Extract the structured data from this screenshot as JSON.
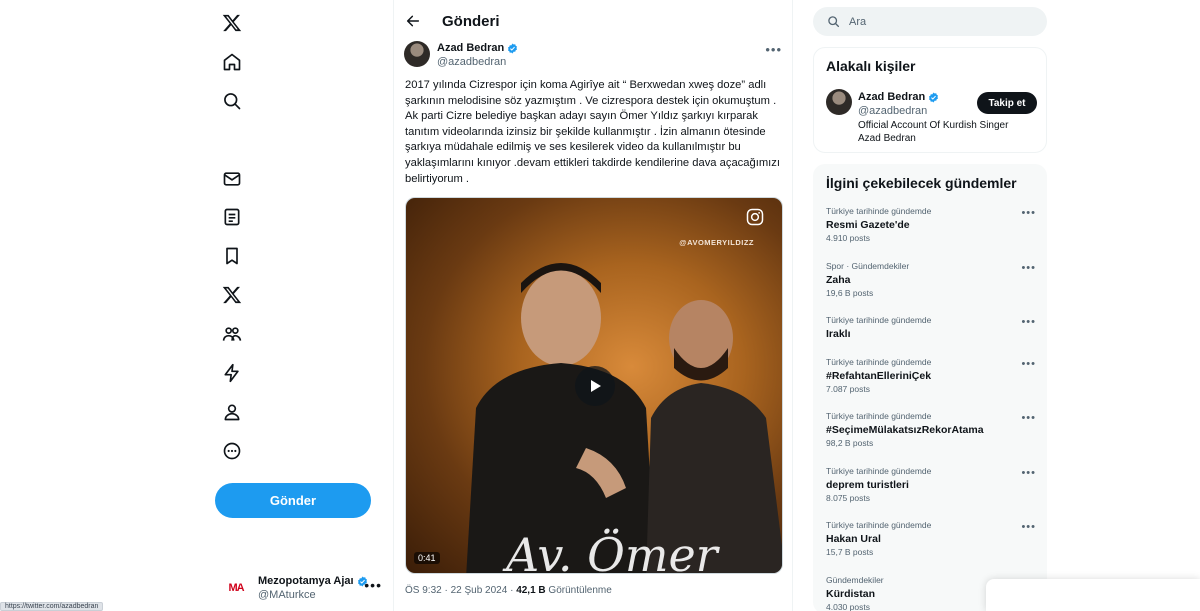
{
  "nav": {
    "items": [
      {
        "icon": "x-logo-icon"
      },
      {
        "icon": "home-icon"
      },
      {
        "icon": "explore-icon"
      },
      {
        "icon": "messages-icon"
      },
      {
        "icon": "lists-icon"
      },
      {
        "icon": "bookmarks-icon"
      },
      {
        "icon": "premium-x-icon"
      },
      {
        "icon": "communities-icon"
      },
      {
        "icon": "verified-orgs-icon"
      },
      {
        "icon": "profile-icon"
      },
      {
        "icon": "more-icon"
      }
    ],
    "post_button": "Gönder",
    "account": {
      "name": "Mezopotamya Ajaı",
      "handle": "@MAturkce",
      "avatar_text": "MA"
    }
  },
  "main": {
    "header_title": "Gönderi",
    "author": {
      "name": "Azad Bedran",
      "handle": "@azadbedran"
    },
    "text": "2017 yılında Cizrespor için koma Agirîye ait “ Berxwedan xweş doze” adlı şarkının melodisine söz yazmıştım . Ve cizrespora destek için okumuştum . Ak parti Cizre belediye başkan adayı sayın Ömer Yıldız şarkıyı kırparak tanıtım videolarında izinsiz bir şekilde kullanmıştır . İzin almanın ötesinde şarkıya müdahale edilmiş ve ses kesilerek video da kullanılmıştır bu yaklaşımlarını kınıyor .devam ettikleri takdirde kendilerine dava açacağımızı belirtiyorum .",
    "media": {
      "watermark": "@AVOMERYILDIZZ",
      "duration": "0:41",
      "overlay_script": "Av. Ömer"
    },
    "meta": {
      "time_date": "ÖS 9:32 · 22 Şub 2024 · ",
      "views_count": "42,1 B",
      "views_label": " Görüntülenme"
    }
  },
  "right": {
    "search_placeholder": "Ara",
    "related": {
      "title": "Alakalı kişiler",
      "name": "Azad Bedran",
      "handle": "@azadbedran",
      "follow_label": "Takip et",
      "bio": "Official Account Of Kurdish Singer Azad Bedran"
    },
    "trends_title": "İlgini çekebilecek gündemler",
    "trends": [
      {
        "context": "Türkiye tarihinde gündemde",
        "name": "Resmi Gazete'de",
        "count": "4.910 posts"
      },
      {
        "context": "Spor · Gündemdekiler",
        "name": "Zaha",
        "count": "19,6 B posts"
      },
      {
        "context": "Türkiye tarihinde gündemde",
        "name": "Iraklı",
        "count": ""
      },
      {
        "context": "Türkiye tarihinde gündemde",
        "name": "#RefahtanElleriniÇek",
        "count": "7.087 posts"
      },
      {
        "context": "Türkiye tarihinde gündemde",
        "name": "#SeçimeMülakatsızRekorAtama",
        "count": "98,2 B posts"
      },
      {
        "context": "Türkiye tarihinde gündemde",
        "name": "deprem turistleri",
        "count": "8.075 posts"
      },
      {
        "context": "Türkiye tarihinde gündemde",
        "name": "Hakan Ural",
        "count": "15,7 B posts"
      },
      {
        "context": "Gündemdekiler",
        "name": "Kürdistan",
        "count": "4.030 posts"
      }
    ]
  },
  "status_url": "https://twitter.com/azadbedran",
  "colors": {
    "accent": "#1d9bf0",
    "text": "#0f1419",
    "muted": "#536471"
  }
}
